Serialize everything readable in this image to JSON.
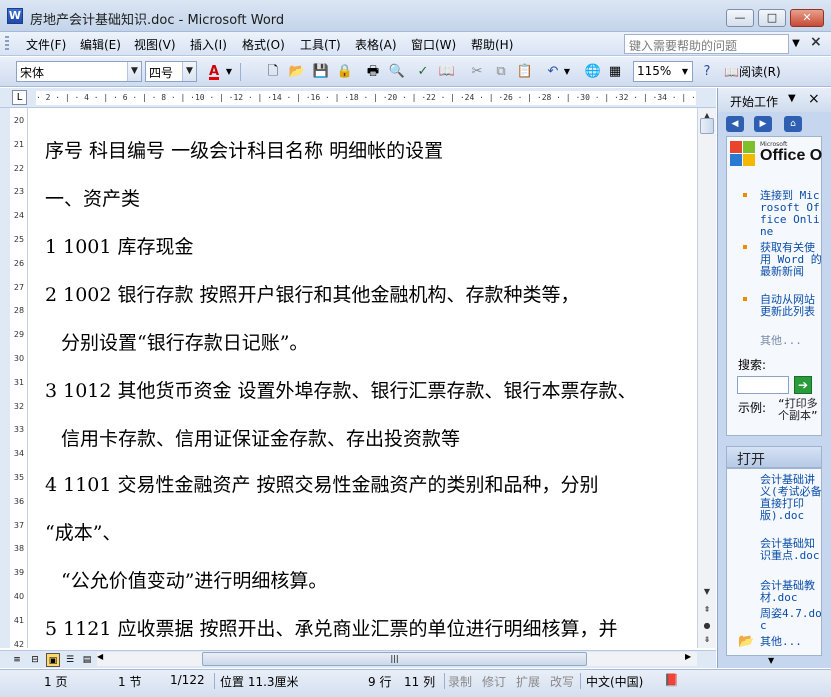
{
  "window": {
    "title": "房地产会计基础知识.doc - Microsoft Word",
    "minimize": "—",
    "maximize": "□",
    "close": "✕"
  },
  "menu": {
    "items": [
      "文件(F)",
      "编辑(E)",
      "视图(V)",
      "插入(I)",
      "格式(O)",
      "工具(T)",
      "表格(A)",
      "窗口(W)",
      "帮助(H)"
    ],
    "help_placeholder": "键入需要帮助的问题",
    "close_doc": "×"
  },
  "toolbar": {
    "font": "宋体",
    "size": "四号",
    "font_color_label": "A",
    "zoom": "115%",
    "read_label": "阅读(R)"
  },
  "ruler": {
    "corner": "L",
    "ticks": "  · 2 · | · 4 · | · 6 · | · 8 · | ·10 · | ·12 · | ·14 · | ·16 · | ·18 · | ·20 · | ·22 · | ·24 · | ·26 · | ·28 · | ·30 · | ·32 · | ·34 · | ·36 · | ·38 · | ·40",
    "vertical": [
      "20",
      "21",
      "22",
      "23",
      "24",
      "25",
      "26",
      "27",
      "28",
      "29",
      "30",
      "31",
      "32",
      "33",
      "34",
      "35",
      "36",
      "37",
      "38",
      "39",
      "40",
      "41",
      "42"
    ]
  },
  "document": {
    "lines": [
      "序号  科目编号  一级会计科目名称  明细帐的设置",
      "一、资产类",
      "1 1001  库存现金",
      "2 1002  银行存款  按照开户银行和其他金融机构、存款种类等，",
      "分别设置“银行存款日记账”。",
      "3 1012  其他货币资金  设置外埠存款、银行汇票存款、银行本票存款、",
      "信用卡存款、信用证保证金存款、存出投资款等",
      "4  1101  交易性金融资产  按照交易性金融资产的类别和品种，分别",
      "“成本”、",
      "“公允价值变动”进行明细核算。",
      "5 1121  应收票据  按照开出、承兑商业汇票的单位进行明细核算，并"
    ]
  },
  "statusbar": {
    "page": "1 页",
    "section": "1 节",
    "page_of": "1/122",
    "position": "位置 11.3厘米",
    "line": "9 行",
    "column": "11 列",
    "rec": "录制",
    "trk": "修订",
    "ext": "扩展",
    "ovr": "改写",
    "language": "中文(中国)"
  },
  "taskpane": {
    "title": "开始工作",
    "logo_small": "Microsoft",
    "logo_big": "Office O",
    "links": [
      "连接到 Microsoft Office Online",
      "获取有关使用 Word 的最新新闻",
      "自动从网站更新此列表"
    ],
    "more": "其他...",
    "search_label": "搜索:",
    "example_label": "示例:",
    "example_text": "“打印多个副本”",
    "open_title": "打开",
    "docs": [
      "会计基础讲义(考试必备直接打印版).doc",
      "会计基础知识重点.doc",
      "会计基础教材.doc",
      "周姿4.7.doc"
    ],
    "more_docs": "其他..."
  }
}
